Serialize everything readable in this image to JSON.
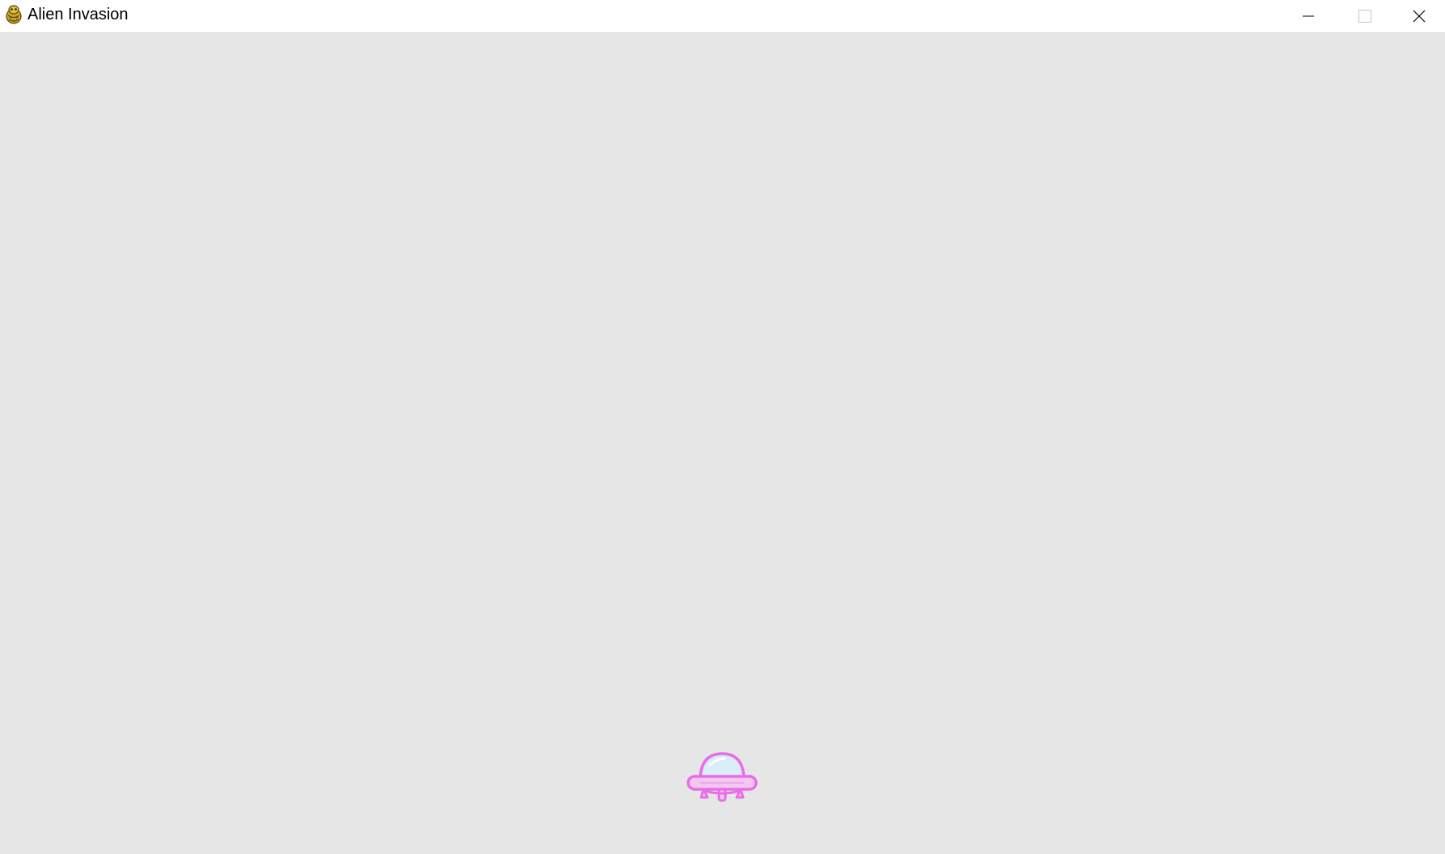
{
  "window": {
    "title": "Alien Invasion",
    "app_icon": "pygame-snake-icon",
    "controls": {
      "minimize_icon": "minimize-icon",
      "maximize_icon": "maximize-icon",
      "close_icon": "close-icon"
    }
  },
  "game": {
    "background_color": "#e6e6e6",
    "ship": {
      "icon": "ufo-ship-icon",
      "outline_color": "#e86ee8",
      "dome_color": "#d8eef8"
    }
  }
}
